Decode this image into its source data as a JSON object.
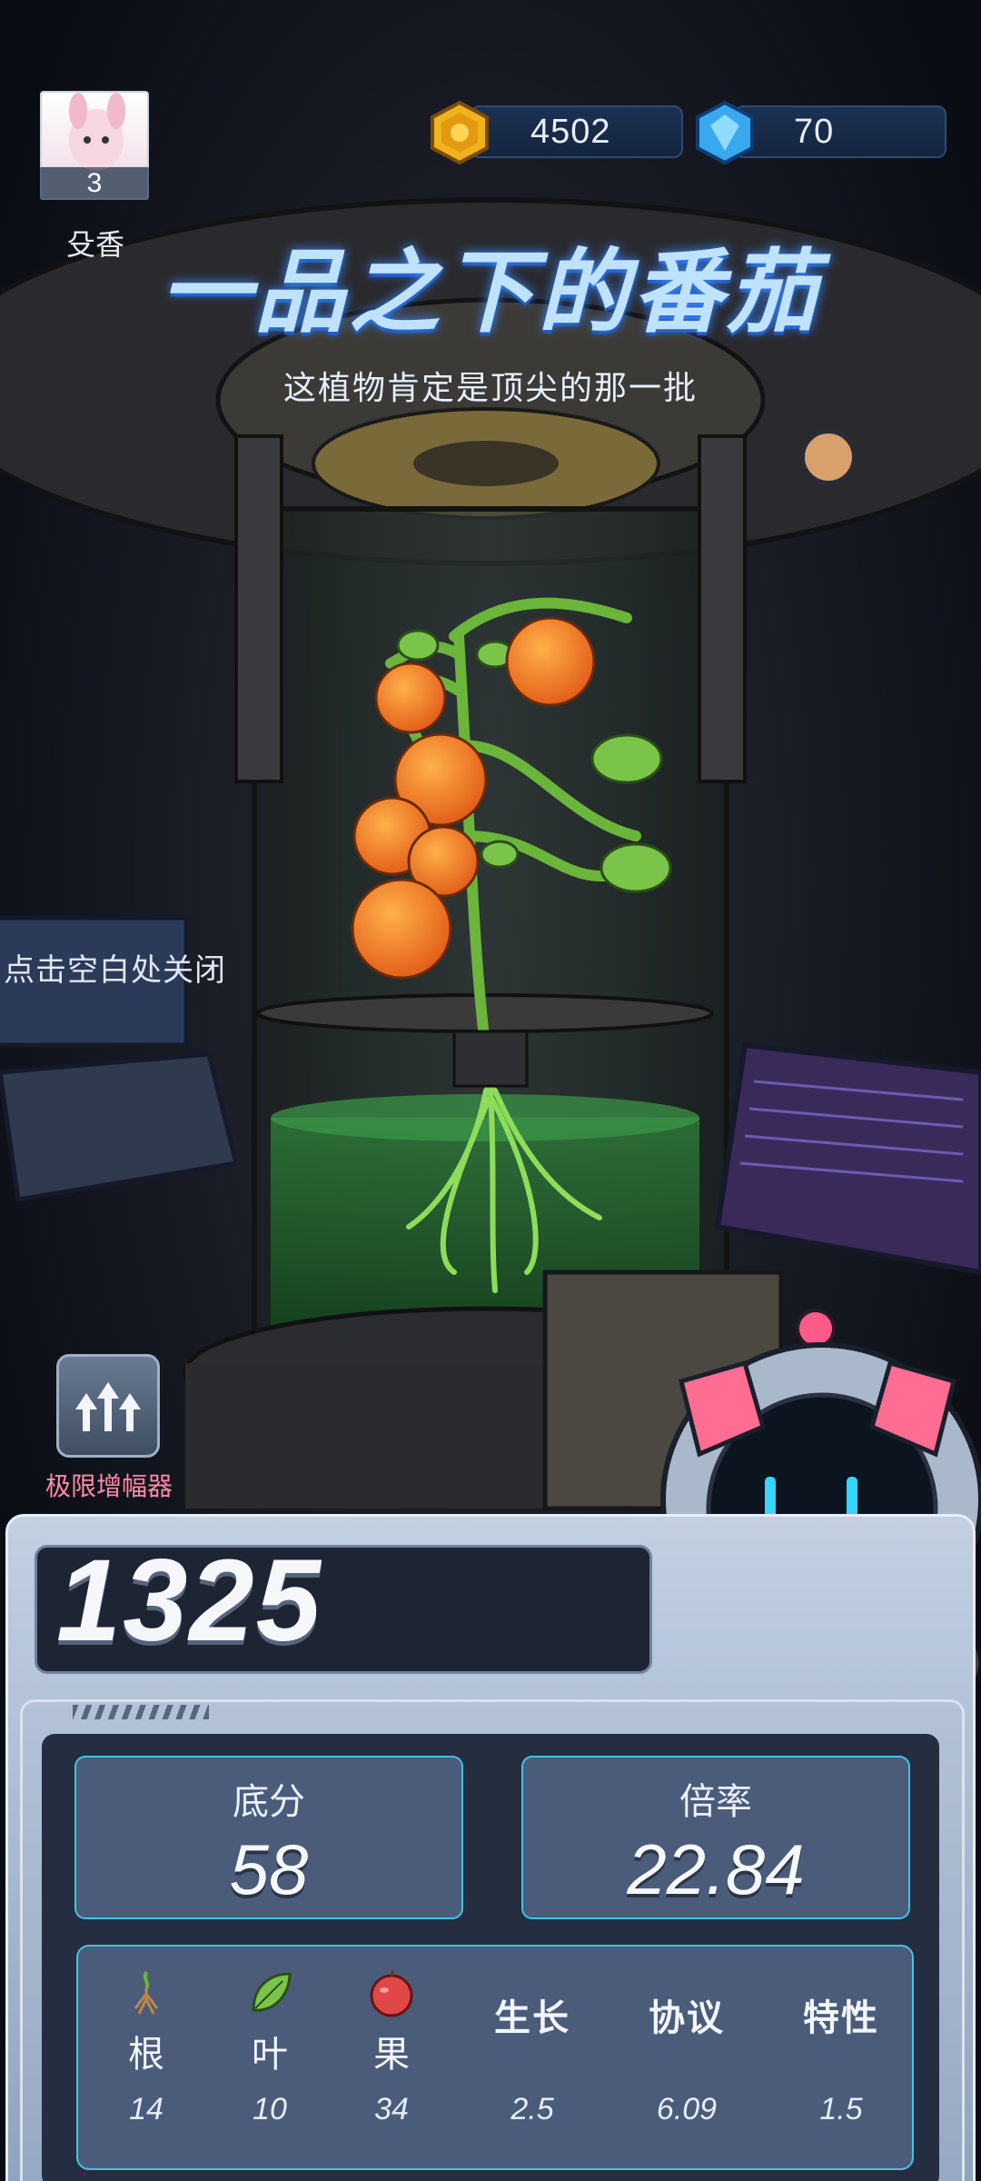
{
  "player": {
    "name": "殳香",
    "level": "3"
  },
  "currencies": {
    "coins": {
      "icon": "gold-coin-icon",
      "value": "4502"
    },
    "gems": {
      "icon": "blue-gem-icon",
      "value": "70"
    }
  },
  "plant": {
    "title": "一品之下的番茄",
    "subtitle": "这植物肯定是顶尖的那一批"
  },
  "hint": {
    "close_text": "点击空白处关闭"
  },
  "amplifier": {
    "label": "极限增幅器",
    "icon": "triple-arrow-up-icon"
  },
  "score": {
    "total": "1325",
    "base_label": "底分",
    "base_value": "58",
    "multiplier_label": "倍率",
    "multiplier_value": "22.84"
  },
  "details": [
    {
      "label": "根",
      "icon": "root-icon",
      "value": "14"
    },
    {
      "label": "叶",
      "icon": "leaf-icon",
      "value": "10"
    },
    {
      "label": "果",
      "icon": "apple-icon",
      "value": "34"
    },
    {
      "label": "生长",
      "value": "2.5"
    },
    {
      "label": "协议",
      "value": "6.09"
    },
    {
      "label": "特性",
      "value": "1.5"
    }
  ],
  "colors": {
    "title_glow": "#3a88ff",
    "panel_accent": "#3fc4e8",
    "amplifier_label": "#ff8aa8",
    "tomato": "#f07a1c"
  }
}
